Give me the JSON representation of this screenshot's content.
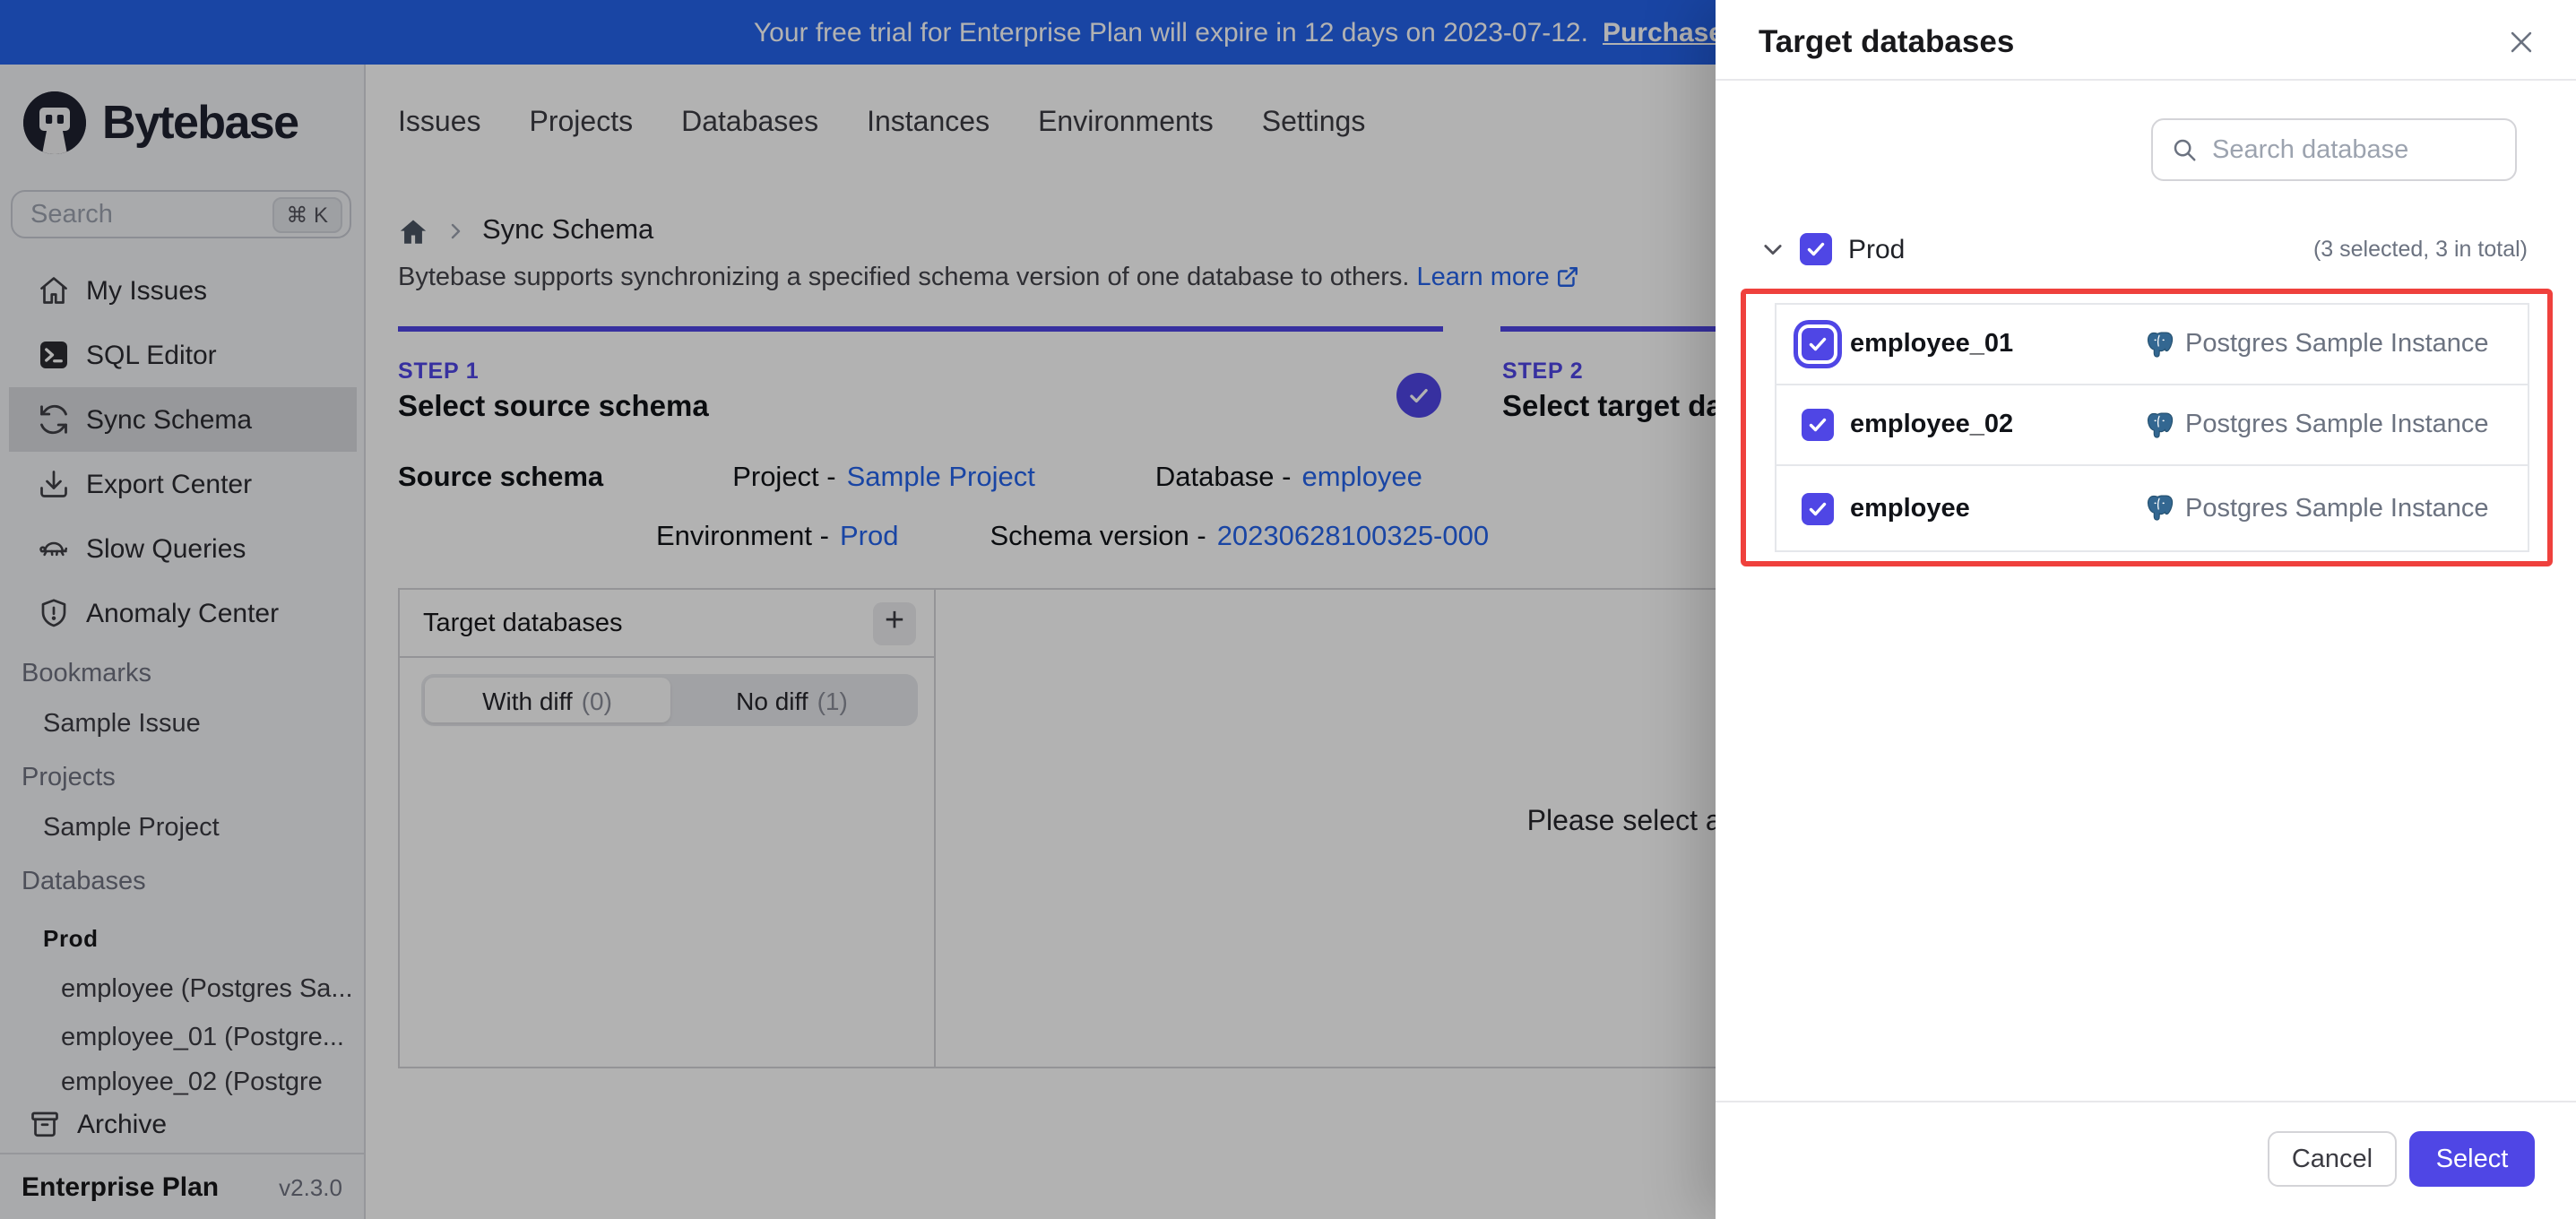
{
  "banner": {
    "message": "Your free trial for Enterprise Plan will expire in 12 days on 2023-07-12.",
    "link_label": "Purchase license"
  },
  "brand": {
    "name": "Bytebase"
  },
  "sidebar": {
    "search_placeholder": "Search",
    "search_shortcut": "⌘ K",
    "menu": [
      {
        "label": "My Issues",
        "icon": "home-icon"
      },
      {
        "label": "SQL Editor",
        "icon": "terminal-icon"
      },
      {
        "label": "Sync Schema",
        "icon": "sync-icon"
      },
      {
        "label": "Export Center",
        "icon": "download-icon"
      },
      {
        "label": "Slow Queries",
        "icon": "turtle-icon"
      },
      {
        "label": "Anomaly Center",
        "icon": "shield-alert-icon"
      }
    ],
    "sections": {
      "bookmarks": {
        "label": "Bookmarks",
        "items": [
          "Sample Issue"
        ]
      },
      "projects": {
        "label": "Projects",
        "items": [
          "Sample Project"
        ]
      },
      "databases": {
        "label": "Databases",
        "environment": "Prod",
        "items": [
          "employee (Postgres Sa...",
          "employee_01 (Postgre...",
          "employee_02 (Postgre"
        ]
      }
    },
    "archive_label": "Archive",
    "plan": "Enterprise Plan",
    "version": "v2.3.0"
  },
  "topnav": {
    "items": [
      "Issues",
      "Projects",
      "Databases",
      "Instances",
      "Environments",
      "Settings"
    ]
  },
  "main": {
    "breadcrumb": {
      "page": "Sync Schema"
    },
    "description": "Bytebase supports synchronizing a specified schema version of one database to others.",
    "learn_more_label": "Learn more",
    "step1": {
      "eyebrow": "STEP 1",
      "title": "Select source schema"
    },
    "step2": {
      "eyebrow": "STEP 2",
      "title": "Select target databases"
    },
    "source": {
      "label": "Source schema",
      "project_label": "Project -",
      "project_value": "Sample Project",
      "database_label": "Database -",
      "database_value": "employee",
      "environment_label": "Environment -",
      "environment_value": "Prod",
      "version_label": "Schema version -",
      "version_value": "20230628100325-000"
    },
    "target_panel": {
      "title": "Target databases",
      "add_label": "+",
      "tabs": [
        {
          "label": "With diff",
          "count": "(0)"
        },
        {
          "label": "No diff",
          "count": "(1)"
        }
      ],
      "empty_message": "Please select a target database first"
    }
  },
  "drawer": {
    "title": "Target databases",
    "search_placeholder": "Search database",
    "group": {
      "name": "Prod",
      "summary": "(3 selected, 3 in total)"
    },
    "databases": [
      {
        "name": "employee_01",
        "instance": "Postgres Sample Instance"
      },
      {
        "name": "employee_02",
        "instance": "Postgres Sample Instance"
      },
      {
        "name": "employee",
        "instance": "Postgres Sample Instance"
      }
    ],
    "cancel_label": "Cancel",
    "select_label": "Select"
  },
  "colors": {
    "accent": "#4f46e5",
    "banner_blue": "#2563eb",
    "link_blue": "#2563eb",
    "annotation_red": "#ef413d",
    "postgres_blue": "#336791"
  }
}
